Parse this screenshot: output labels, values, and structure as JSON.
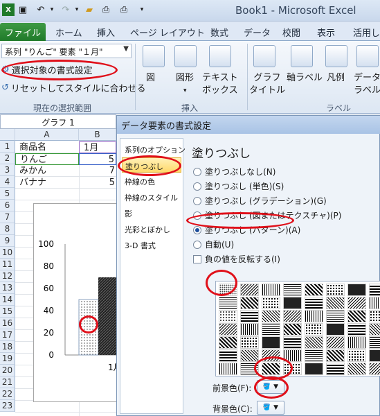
{
  "window": {
    "title": "Book1 - Microsoft Excel"
  },
  "ribbon_tabs": [
    "ファイル",
    "ホーム",
    "挿入",
    "ページ レイアウト",
    "数式",
    "データ",
    "校閲",
    "表示",
    "活用し"
  ],
  "selection": {
    "dropdown_value": "系列 \"りんご\" 要素 \"１月\"",
    "format_selection": "選択対象の書式設定",
    "reset_style": "リセットしてスタイルに合わせる",
    "group_label": "現在の選択範囲"
  },
  "insert_group": {
    "picture": "図",
    "shapes": "図形",
    "textbox": "テキスト\nボックス",
    "label": "挿入"
  },
  "labels_group": {
    "chart_title": "グラフ\nタイトル",
    "axis_title": "軸ラベル",
    "legend": "凡例",
    "data_labels": "データ\nラベル",
    "label": "ラベル"
  },
  "sheet": {
    "name_box": "グラフ 1",
    "columns": [
      "A",
      "B"
    ],
    "rows": [
      "1",
      "2",
      "3",
      "4",
      "5",
      "6",
      "7",
      "8",
      "9",
      "10",
      "11",
      "12",
      "13",
      "14",
      "15",
      "16",
      "17",
      "18",
      "19",
      "20",
      "21",
      "22",
      "23"
    ],
    "cells": [
      {
        "a": "商品名",
        "b": "1月"
      },
      {
        "a": "りんご",
        "b": "5"
      },
      {
        "a": "みかん",
        "b": "7"
      },
      {
        "a": "バナナ",
        "b": "5"
      }
    ]
  },
  "chart_data": {
    "type": "bar",
    "categories": [
      "1月"
    ],
    "series": [
      {
        "name": "りんご",
        "values": [
          50
        ],
        "pattern": "dots"
      },
      {
        "name": "",
        "values": [
          70
        ],
        "pattern": "dense-diagonal"
      }
    ],
    "y_ticks": [
      "100",
      "80",
      "60",
      "40",
      "20",
      "0"
    ],
    "ylim": [
      0,
      100
    ],
    "x_label": "1月"
  },
  "dialog": {
    "title": "データ要素の書式設定",
    "nav": [
      "系列のオプション",
      "塗りつぶし",
      "枠線の色",
      "枠線のスタイル",
      "影",
      "光彩とぼかし",
      "3-D 書式"
    ],
    "panel_title": "塗りつぶし",
    "options": [
      "塗りつぶしなし(N)",
      "塗りつぶし (単色)(S)",
      "塗りつぶし (グラデーション)(G)",
      "塗りつぶし (図またはテクスチャ)(P)",
      "塗りつぶし (パターン)(A)",
      "自動(U)"
    ],
    "invert_label": "負の値を反転する(I)",
    "fg_label": "前景色(F):",
    "bg_label": "背景色(C):"
  },
  "colors": {
    "accent_red": "#e0101a",
    "file_tab": "#2b8a36",
    "selected_nav": "#ffd86a"
  }
}
